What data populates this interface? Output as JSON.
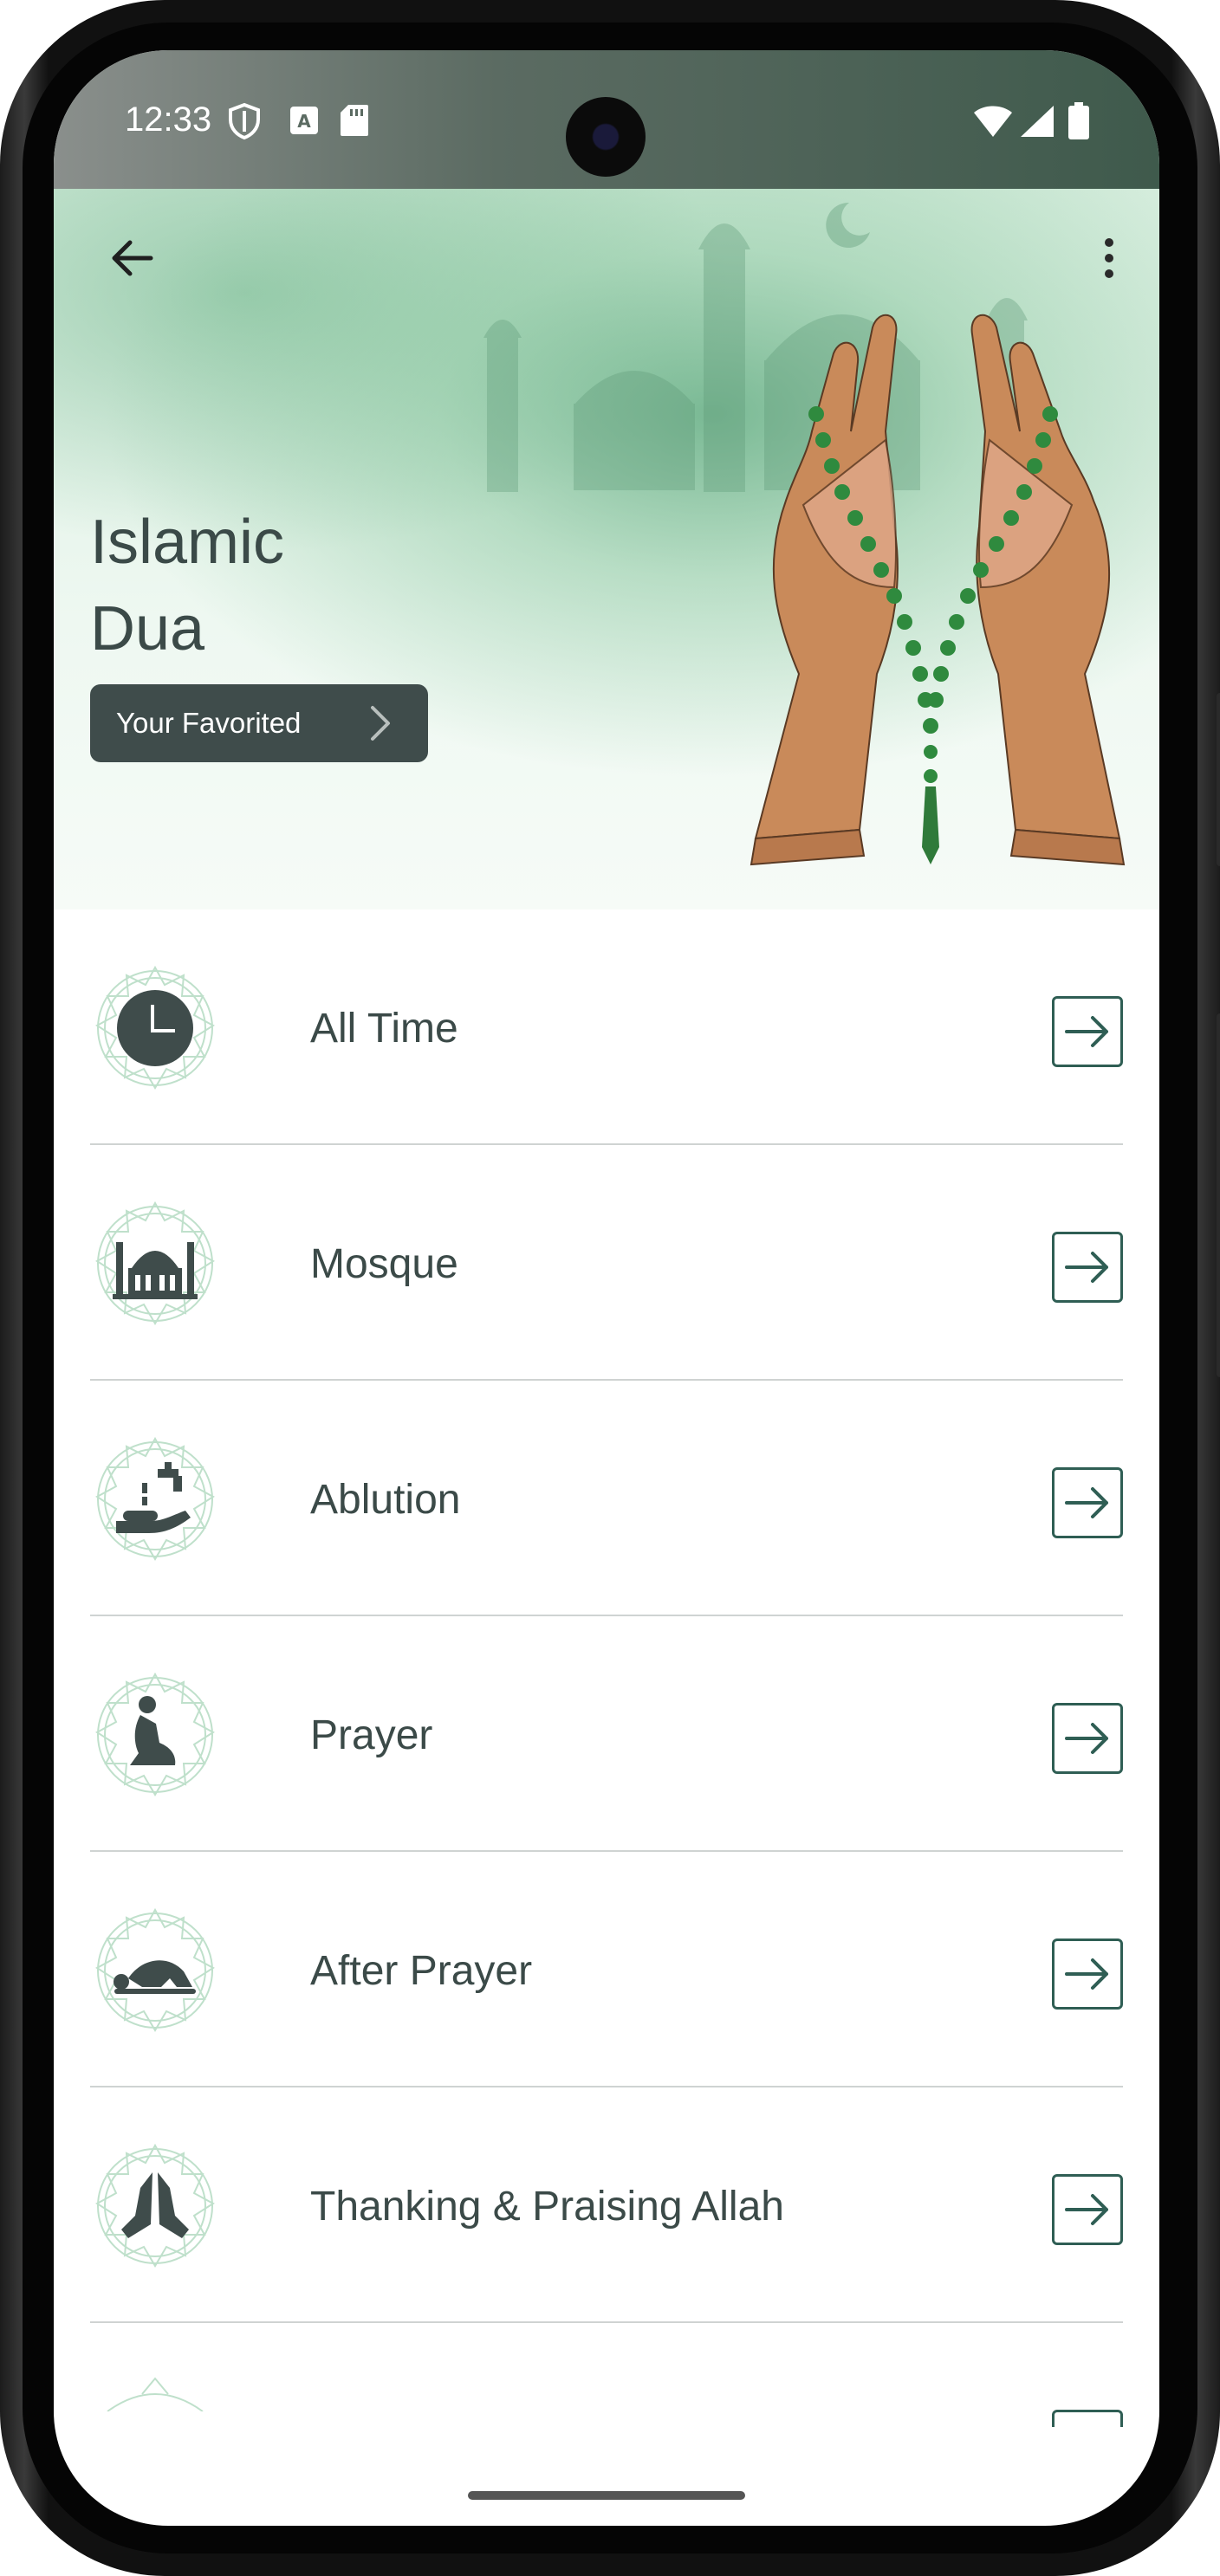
{
  "status_bar": {
    "time": "12:33"
  },
  "header": {
    "title_line1": "Islamic",
    "title_line2": "Dua",
    "favorited_button_label": "Your Favorited"
  },
  "list": {
    "items": [
      {
        "label": "All Time",
        "icon": "clock-icon"
      },
      {
        "label": "Mosque",
        "icon": "mosque-icon"
      },
      {
        "label": "Ablution",
        "icon": "ablution-icon"
      },
      {
        "label": "Prayer",
        "icon": "prayer-icon"
      },
      {
        "label": "After Prayer",
        "icon": "prostration-icon"
      },
      {
        "label": "Thanking & Praising Allah",
        "icon": "praying-hands-icon"
      }
    ]
  },
  "colors": {
    "accent_green": "#2f5e54",
    "text_dark": "#3b4a48",
    "button_bg": "#3f4c4b",
    "header_green": "#4ca070"
  }
}
